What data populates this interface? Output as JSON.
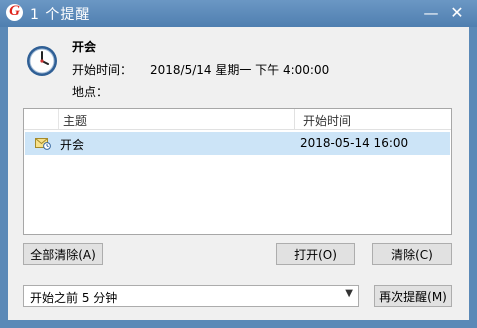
{
  "window": {
    "title": "1 个提醒",
    "logo_letter": "G",
    "minimize_glyph": "—",
    "close_glyph": "✕"
  },
  "reminder": {
    "subject": "开会",
    "start_label": "开始时间：",
    "start_value": "2018/5/14 星期一 下午 4:00:00",
    "location_label": "地点："
  },
  "list": {
    "columns": [
      "主题",
      "开始时间"
    ],
    "rows": [
      {
        "icon": "meeting-reminder-icon",
        "subject": "开会",
        "start": "2018-05-14 16:00",
        "selected": true
      }
    ]
  },
  "buttons": {
    "clear_all": "全部清除(A)",
    "open": "打开(O)",
    "clear": "清除(C)",
    "snooze": "再次提醒(M)"
  },
  "snooze": {
    "selected": "开始之前 5 分钟"
  },
  "colors": {
    "titlebar": "#5b89b7",
    "selected_row": "#cce4f7",
    "logo_red": "#e0231b"
  }
}
